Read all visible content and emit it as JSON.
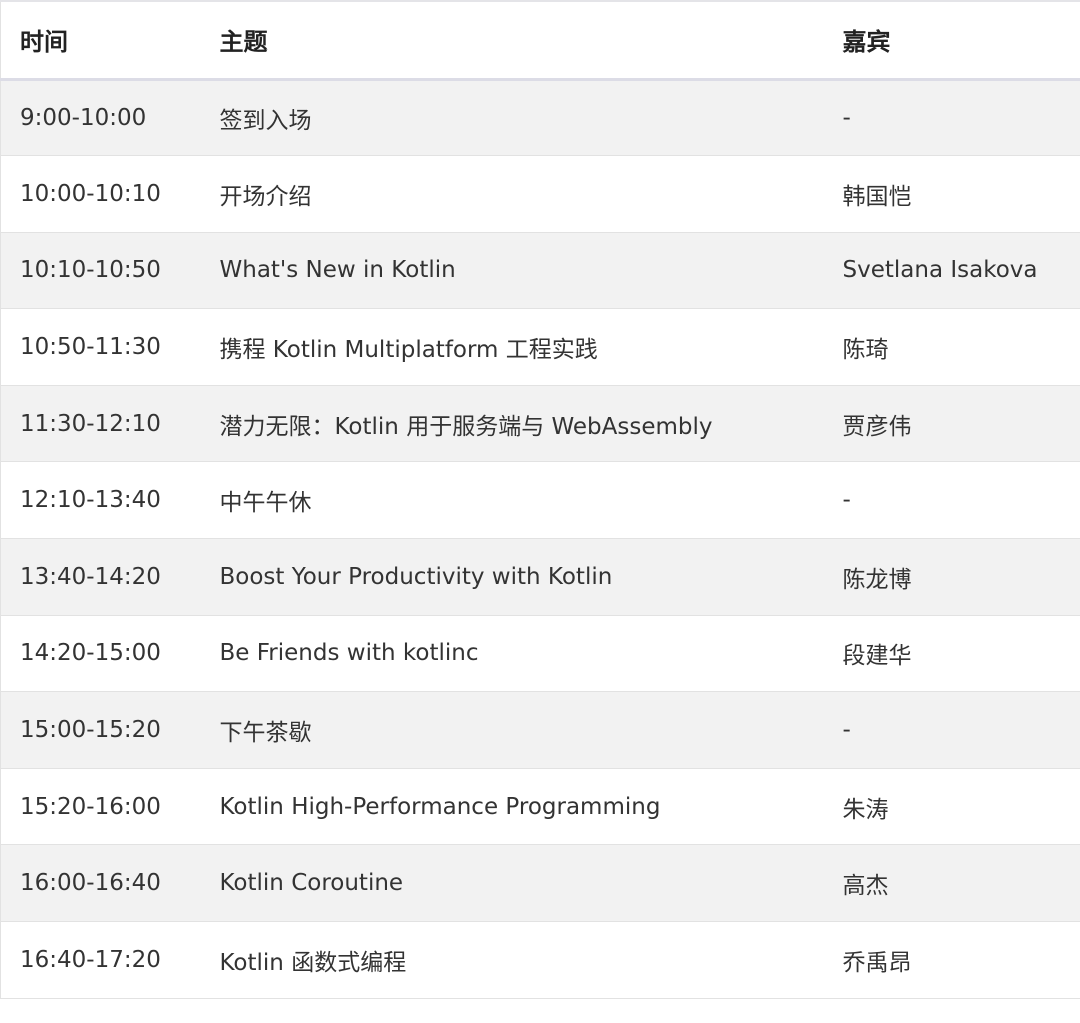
{
  "table": {
    "headers": [
      "时间",
      "主题",
      "嘉宾"
    ],
    "rows": [
      {
        "time": "9:00-10:00",
        "topic": "签到入场",
        "speaker": "-"
      },
      {
        "time": "10:00-10:10",
        "topic": "开场介绍",
        "speaker": "韩国恺"
      },
      {
        "time": "10:10-10:50",
        "topic": "What's New in Kotlin",
        "speaker": "Svetlana Isakova"
      },
      {
        "time": "10:50-11:30",
        "topic": "携程 Kotlin Multiplatform 工程实践",
        "speaker": "陈琦"
      },
      {
        "time": "11:30-12:10",
        "topic": "潜力无限：Kotlin 用于服务端与 WebAssembly",
        "speaker": "贾彦伟"
      },
      {
        "time": "12:10-13:40",
        "topic": "中午午休",
        "speaker": "-"
      },
      {
        "time": "13:40-14:20",
        "topic": "Boost Your Productivity with Kotlin",
        "speaker": "陈龙博"
      },
      {
        "time": "14:20-15:00",
        "topic": "Be Friends with kotlinc",
        "speaker": "段建华"
      },
      {
        "time": "15:00-15:20",
        "topic": "下午茶歇",
        "speaker": "-"
      },
      {
        "time": "15:20-16:00",
        "topic": "Kotlin High-Performance Programming",
        "speaker": "朱涛"
      },
      {
        "time": "16:00-16:40",
        "topic": "Kotlin Coroutine",
        "speaker": "高杰"
      },
      {
        "time": "16:40-17:20",
        "topic": "Kotlin 函数式编程",
        "speaker": "乔禹昂"
      }
    ]
  }
}
